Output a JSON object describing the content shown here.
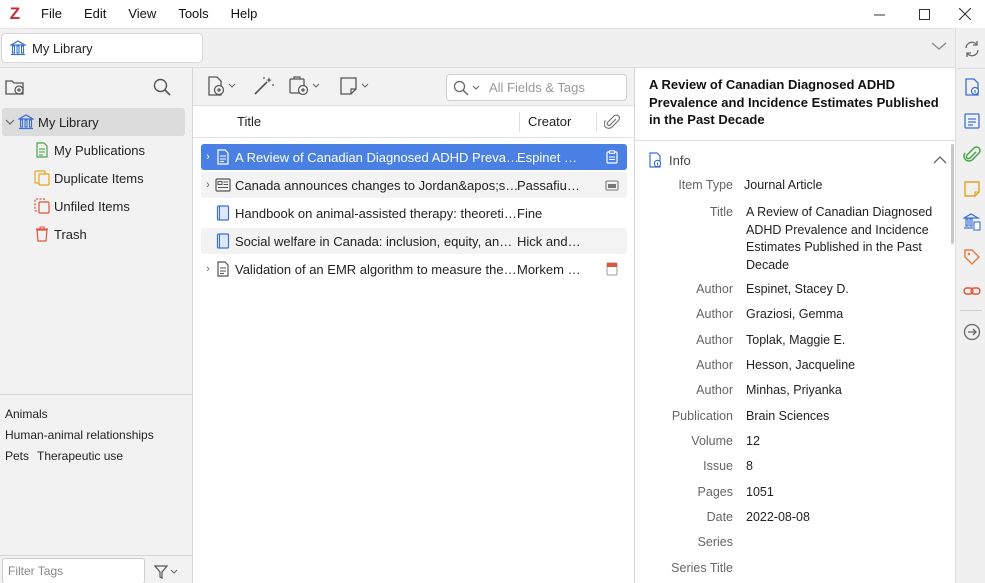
{
  "app": {
    "logo": "Z"
  },
  "menubar": {
    "items": [
      "File",
      "Edit",
      "View",
      "Tools",
      "Help"
    ]
  },
  "tab": {
    "label": "My Library"
  },
  "collections": {
    "items": [
      {
        "label": "My Library",
        "icon": "library-icon"
      },
      {
        "label": "My Publications",
        "icon": "publications-icon"
      },
      {
        "label": "Duplicate Items",
        "icon": "duplicate-icon"
      },
      {
        "label": "Unfiled Items",
        "icon": "unfiled-icon"
      },
      {
        "label": "Trash",
        "icon": "trash-icon"
      }
    ]
  },
  "tags": {
    "items": [
      "Animals",
      "Human-animal relationships",
      "Pets",
      "Therapeutic use"
    ],
    "filter_placeholder": "Filter Tags"
  },
  "items_pane": {
    "search_placeholder": "All Fields & Tags",
    "columns": {
      "title": "Title",
      "creator": "Creator"
    },
    "rows": [
      {
        "title": "A Review of Canadian Diagnosed ADHD Prevalence and Incidence Estimates Published in the Past Decade",
        "creator": "Espinet et al.",
        "type": "journal-article",
        "attachment": "pdf-snapshot",
        "selected": true
      },
      {
        "title": "Canada announces changes to Jordan&apos;s Principle",
        "creator": "Passafiume",
        "type": "news-article",
        "attachment": "snapshot"
      },
      {
        "title": "Handbook on animal-assisted therapy: theoretical foundations and guidelines for practice",
        "creator": "Fine",
        "type": "book"
      },
      {
        "title": "Social welfare in Canada: inclusion, equity, and social justice",
        "creator": "Hick and Stokes",
        "type": "book"
      },
      {
        "title": "Validation of an EMR algorithm to measure the prevalence of ADHD",
        "creator": "Morkem et al.",
        "type": "document",
        "attachment": "pdf"
      }
    ]
  },
  "item_pane": {
    "title": "A Review of Canadian Diagnosed ADHD Prevalence and Incidence Estimates Published in the Past Decade",
    "section": "Info",
    "fields": [
      {
        "label": "Item Type",
        "value": "Journal Article"
      },
      {
        "label": "Title",
        "value": "A Review of Canadian Diagnosed ADHD Prevalence and Incidence Estimates Published in the Past Decade"
      },
      {
        "label": "Author",
        "value": "Espinet, Stacey D."
      },
      {
        "label": "Author",
        "value": "Graziosi, Gemma"
      },
      {
        "label": "Author",
        "value": "Toplak, Maggie E."
      },
      {
        "label": "Author",
        "value": "Hesson, Jacqueline"
      },
      {
        "label": "Author",
        "value": "Minhas, Priyanka"
      },
      {
        "label": "Publication",
        "value": "Brain Sciences"
      },
      {
        "label": "Volume",
        "value": "12"
      },
      {
        "label": "Issue",
        "value": "8"
      },
      {
        "label": "Pages",
        "value": "1051"
      },
      {
        "label": "Date",
        "value": "2022-08-08"
      },
      {
        "label": "Series",
        "value": ""
      },
      {
        "label": "Series Title",
        "value": ""
      }
    ]
  },
  "colors": {
    "accent": "#4a80e4",
    "brand": "#cc2936"
  }
}
